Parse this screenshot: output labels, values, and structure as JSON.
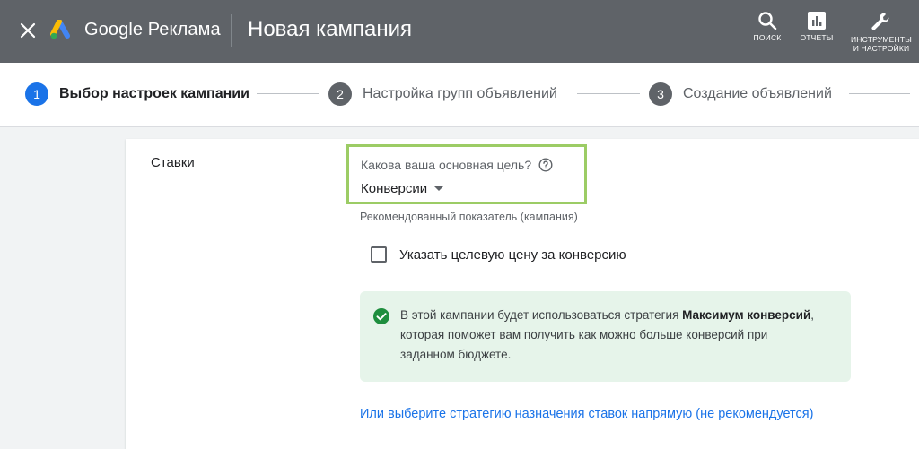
{
  "header": {
    "brand": "Google Реклама",
    "title": "Новая кампания",
    "tools": {
      "search": "ПОИСК",
      "reports": "ОТЧЕТЫ",
      "settings_line1": "ИНСТРУМЕНТЫ",
      "settings_line2": "И НАСТРОЙКИ"
    }
  },
  "stepper": {
    "steps": [
      {
        "num": "1",
        "label": "Выбор настроек кампании",
        "state": "active"
      },
      {
        "num": "2",
        "label": "Настройка групп объявлений",
        "state": "inactive"
      },
      {
        "num": "3",
        "label": "Создание объявлений",
        "state": "inactive"
      }
    ]
  },
  "bidding": {
    "section_label": "Ставки",
    "goal_question": "Какова ваша основная цель?",
    "goal_value": "Конверсии",
    "recommended": "Рекомендованный показатель (кампания)",
    "checkbox_label": "Указать целевую цену за конверсию",
    "checkbox_checked": false,
    "info": {
      "part1": "В этой кампании будет использоваться стратегия ",
      "bold": "Максимум конверсий",
      "part2": ", которая поможет вам получить как можно больше конверсий при заданном бюджете."
    },
    "strategy_link": "Или выберите стратегию назначения ставок напрямую (не рекомендуется)"
  },
  "colors": {
    "header_bg": "#5f6368",
    "active_step": "#1a73e8",
    "highlight_border": "#9ccc65",
    "info_bg": "#e6f4ea",
    "success_icon": "#1e8e3e",
    "link": "#1a73e8"
  },
  "icons": {
    "close": "close-icon",
    "logo": "google-ads-logo-icon",
    "search": "search-icon",
    "reports": "bar-chart-icon",
    "settings": "wrench-icon",
    "help": "help-circle-icon",
    "dropdown": "caret-down-icon",
    "success": "check-circle-icon"
  }
}
